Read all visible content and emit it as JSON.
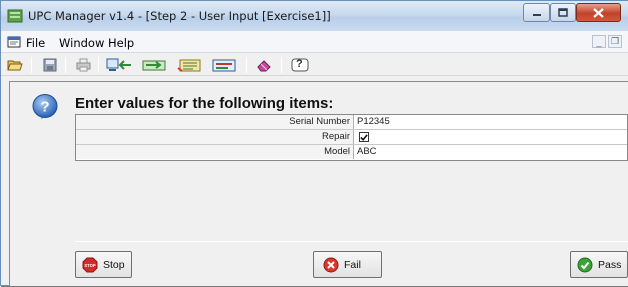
{
  "window": {
    "title": "UPC Manager v1.4 - [Step 2 - User Input [Exercise1]]"
  },
  "menu": {
    "file": "File",
    "window": "Window",
    "help": "Help"
  },
  "mdi_controls": {
    "minimize": "_",
    "restore": "❐"
  },
  "toolbar": {
    "help_glyph": "?"
  },
  "prompt": {
    "heading": "Enter values for the following items:"
  },
  "fields": [
    {
      "label": "Serial Number",
      "value": "P12345",
      "type": "text"
    },
    {
      "label": "Repair",
      "value": "",
      "type": "checkbox",
      "checked": true
    },
    {
      "label": "Model",
      "value": "ABC",
      "type": "text"
    }
  ],
  "buttons": {
    "stop": "Stop",
    "stop_icon_text": "STOP",
    "fail": "Fail",
    "pass": "Pass"
  },
  "colors": {
    "stop_red": "#d42a2a",
    "fail_red": "#d83a2f",
    "pass_green": "#3aa33a",
    "help_blue": "#2f6fc4"
  }
}
